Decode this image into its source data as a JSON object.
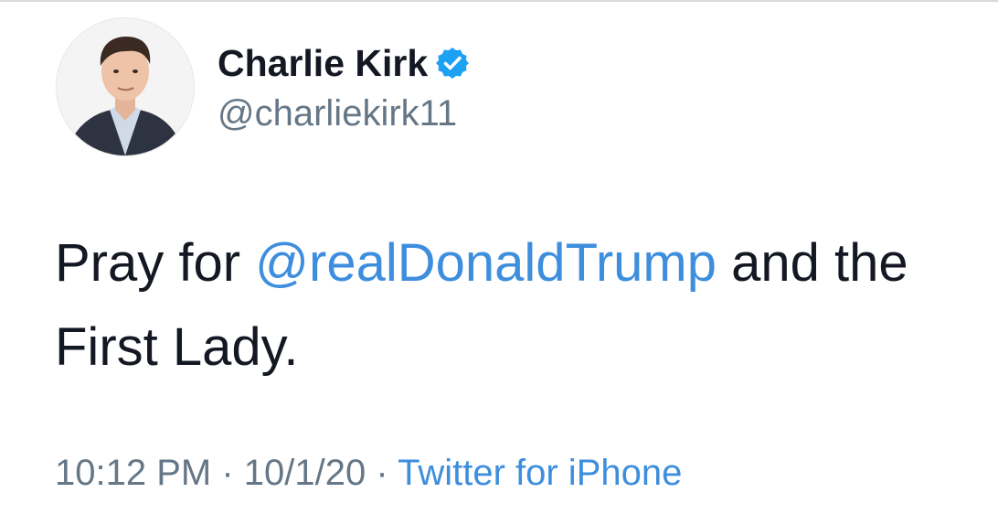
{
  "user": {
    "display_name": "Charlie Kirk",
    "handle": "@charliekirk11",
    "verified_icon": "verified-badge-icon"
  },
  "tweet": {
    "text_before": "Pray for ",
    "mention": "@realDonaldTrump",
    "text_after": " and the First Lady."
  },
  "meta": {
    "time": "10:12 PM",
    "separator": "·",
    "date": "10/1/20",
    "source": "Twitter for iPhone"
  },
  "colors": {
    "link": "#3e8ede",
    "text": "#141823",
    "secondary": "#657786",
    "verified": "#1da1f2"
  }
}
